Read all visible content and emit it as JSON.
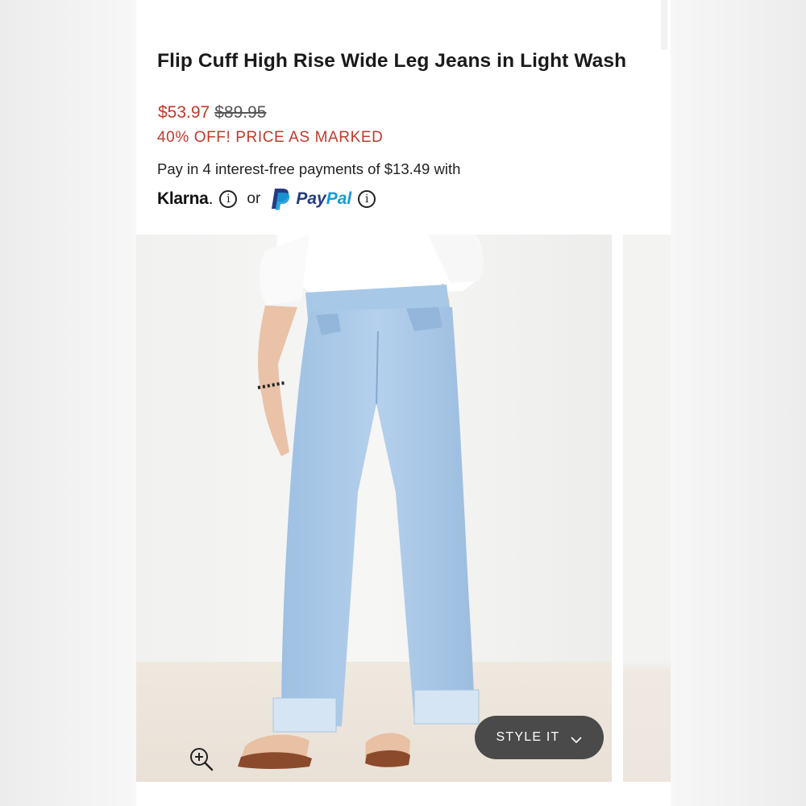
{
  "product": {
    "title": "Flip Cuff High Rise Wide Leg Jeans in Light Wash",
    "sale_price": "$53.97",
    "original_price": "$89.95",
    "promo": "40% OFF! PRICE AS MARKED"
  },
  "payment": {
    "installments_text": "Pay in 4 interest-free payments of $13.49 with",
    "klarna_label": "Klarna",
    "klarna_dot": ".",
    "info_glyph": "i",
    "or_text": "or",
    "paypal_pay": "Pay",
    "paypal_pal": "Pal"
  },
  "gallery": {
    "style_it_label": "STYLE IT",
    "icons": [
      "zoom-in-icon",
      "chevron-down-icon",
      "info-icon",
      "paypal-icon"
    ]
  },
  "colors": {
    "sale": "#c0392b",
    "style_button": "#4a4a4a",
    "paypal_dark": "#253b80",
    "paypal_light": "#179bd7",
    "denim": "#a9c8e6"
  }
}
